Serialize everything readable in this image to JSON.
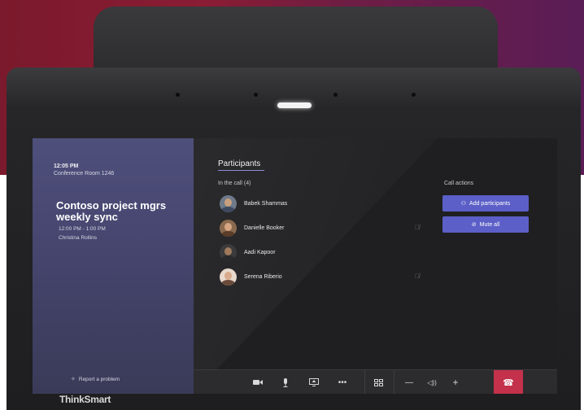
{
  "device": {
    "brand": "ThinkSmart"
  },
  "sidebar": {
    "time": "12:05 PM",
    "room": "Conference Room 1246",
    "meeting_title": "Contoso project mgrs weekly sync",
    "meeting_time": "12:00 PM - 1:00 PM",
    "organizer": "Christina Rollins",
    "report_problem": "Report a problem"
  },
  "participants_panel": {
    "title": "Participants",
    "in_call_label": "In the call (4)",
    "participants": [
      {
        "name": "Babek Shammas",
        "muted": false
      },
      {
        "name": "Danielle Booker",
        "muted": true
      },
      {
        "name": "Aadi Kapoor",
        "muted": false
      },
      {
        "name": "Serena Riberio",
        "muted": true
      }
    ]
  },
  "call_actions": {
    "label": "Call actions",
    "add_participants": "Add participants",
    "mute_all": "Mute all"
  },
  "toolbar": {
    "icons": [
      "camera-icon",
      "microphone-icon",
      "share-screen-icon",
      "more-options-icon",
      "layout-icon",
      "volume-down-icon",
      "volume-icon",
      "volume-up-icon",
      "hang-up-icon"
    ]
  },
  "colors": {
    "accent": "#5b5fc7",
    "hangup": "#c4314b",
    "sidebar": "#4f4f7c",
    "backdrop": "#7b1a2c"
  }
}
